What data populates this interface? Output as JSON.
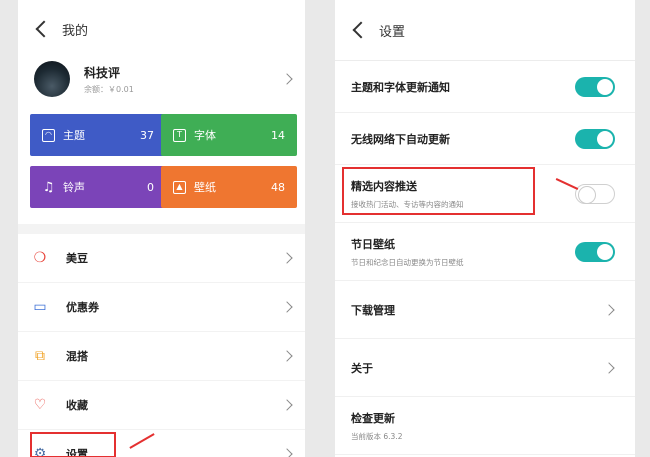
{
  "left": {
    "header_title": "我的",
    "profile": {
      "name": "科技评",
      "balance": "余额：￥0.01"
    },
    "tiles": [
      {
        "label": "主题",
        "count": "37",
        "icon": "theme-icon",
        "color": "#3f5bc6"
      },
      {
        "label": "字体",
        "count": "14",
        "icon": "font-icon",
        "color": "#3fae55"
      },
      {
        "label": "铃声",
        "count": "0",
        "icon": "ringtone-icon",
        "color": "#7b44b8"
      },
      {
        "label": "壁纸",
        "count": "48",
        "icon": "wallpaper-icon",
        "color": "#ef7630"
      }
    ],
    "menu": [
      {
        "label": "美豆",
        "icon": "bean-icon"
      },
      {
        "label": "优惠券",
        "icon": "coupon-icon"
      },
      {
        "label": "混搭",
        "icon": "mix-icon"
      },
      {
        "label": "收藏",
        "icon": "heart-icon"
      },
      {
        "label": "设置",
        "icon": "gear-icon"
      }
    ]
  },
  "right": {
    "header_title": "设置",
    "rows": [
      {
        "label": "主题和字体更新通知",
        "toggle": true
      },
      {
        "label": "无线网络下自动更新",
        "toggle": true
      },
      {
        "label": "精选内容推送",
        "sub": "接收热门活动、专访等内容的通知",
        "toggle": false
      },
      {
        "label": "节日壁纸",
        "sub": "节日和纪念日自动更换为节日壁纸",
        "toggle": true
      },
      {
        "label": "下载管理"
      },
      {
        "label": "关于"
      },
      {
        "label": "检查更新",
        "sub": "当前版本 6.3.2"
      }
    ]
  },
  "colors": {
    "accent_toggle": "#1bb3ad",
    "highlight": "#e43030"
  }
}
